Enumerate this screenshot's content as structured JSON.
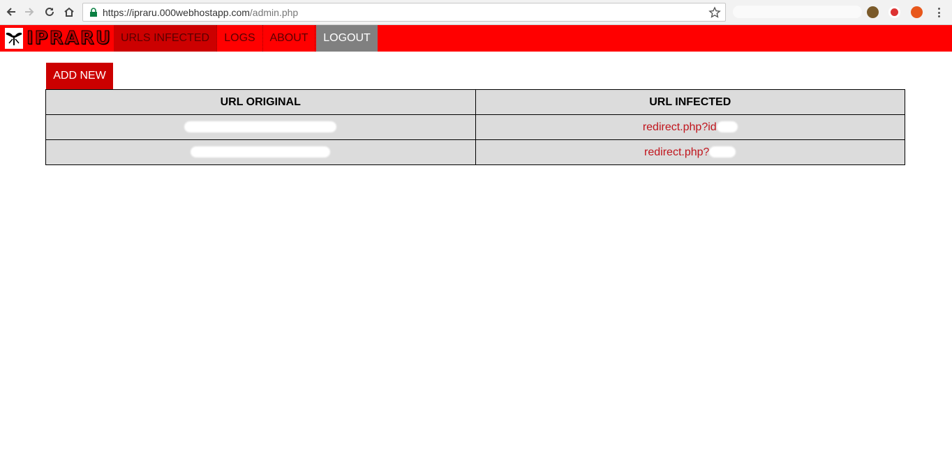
{
  "browser": {
    "url_host": "https://ipraru.000webhostapp.com",
    "url_path": "/admin.php"
  },
  "app": {
    "logo_text": "IPRARU",
    "nav": {
      "urls_infected": "URLS INFECTED",
      "logs": "LOGS",
      "about": "ABOUT",
      "logout": "LOGOUT"
    },
    "add_new_label": "ADD NEW"
  },
  "table": {
    "headers": [
      "URL ORIGINAL",
      "URL INFECTED"
    ],
    "rows": [
      {
        "original": "",
        "infected": "redirect.php?id"
      },
      {
        "original": "",
        "infected": "redirect.php?"
      }
    ]
  },
  "colors": {
    "nav_bg": "#ff0000",
    "nav_active": "#cc0000",
    "logout_bg": "#808080",
    "link": "#c0141c"
  }
}
